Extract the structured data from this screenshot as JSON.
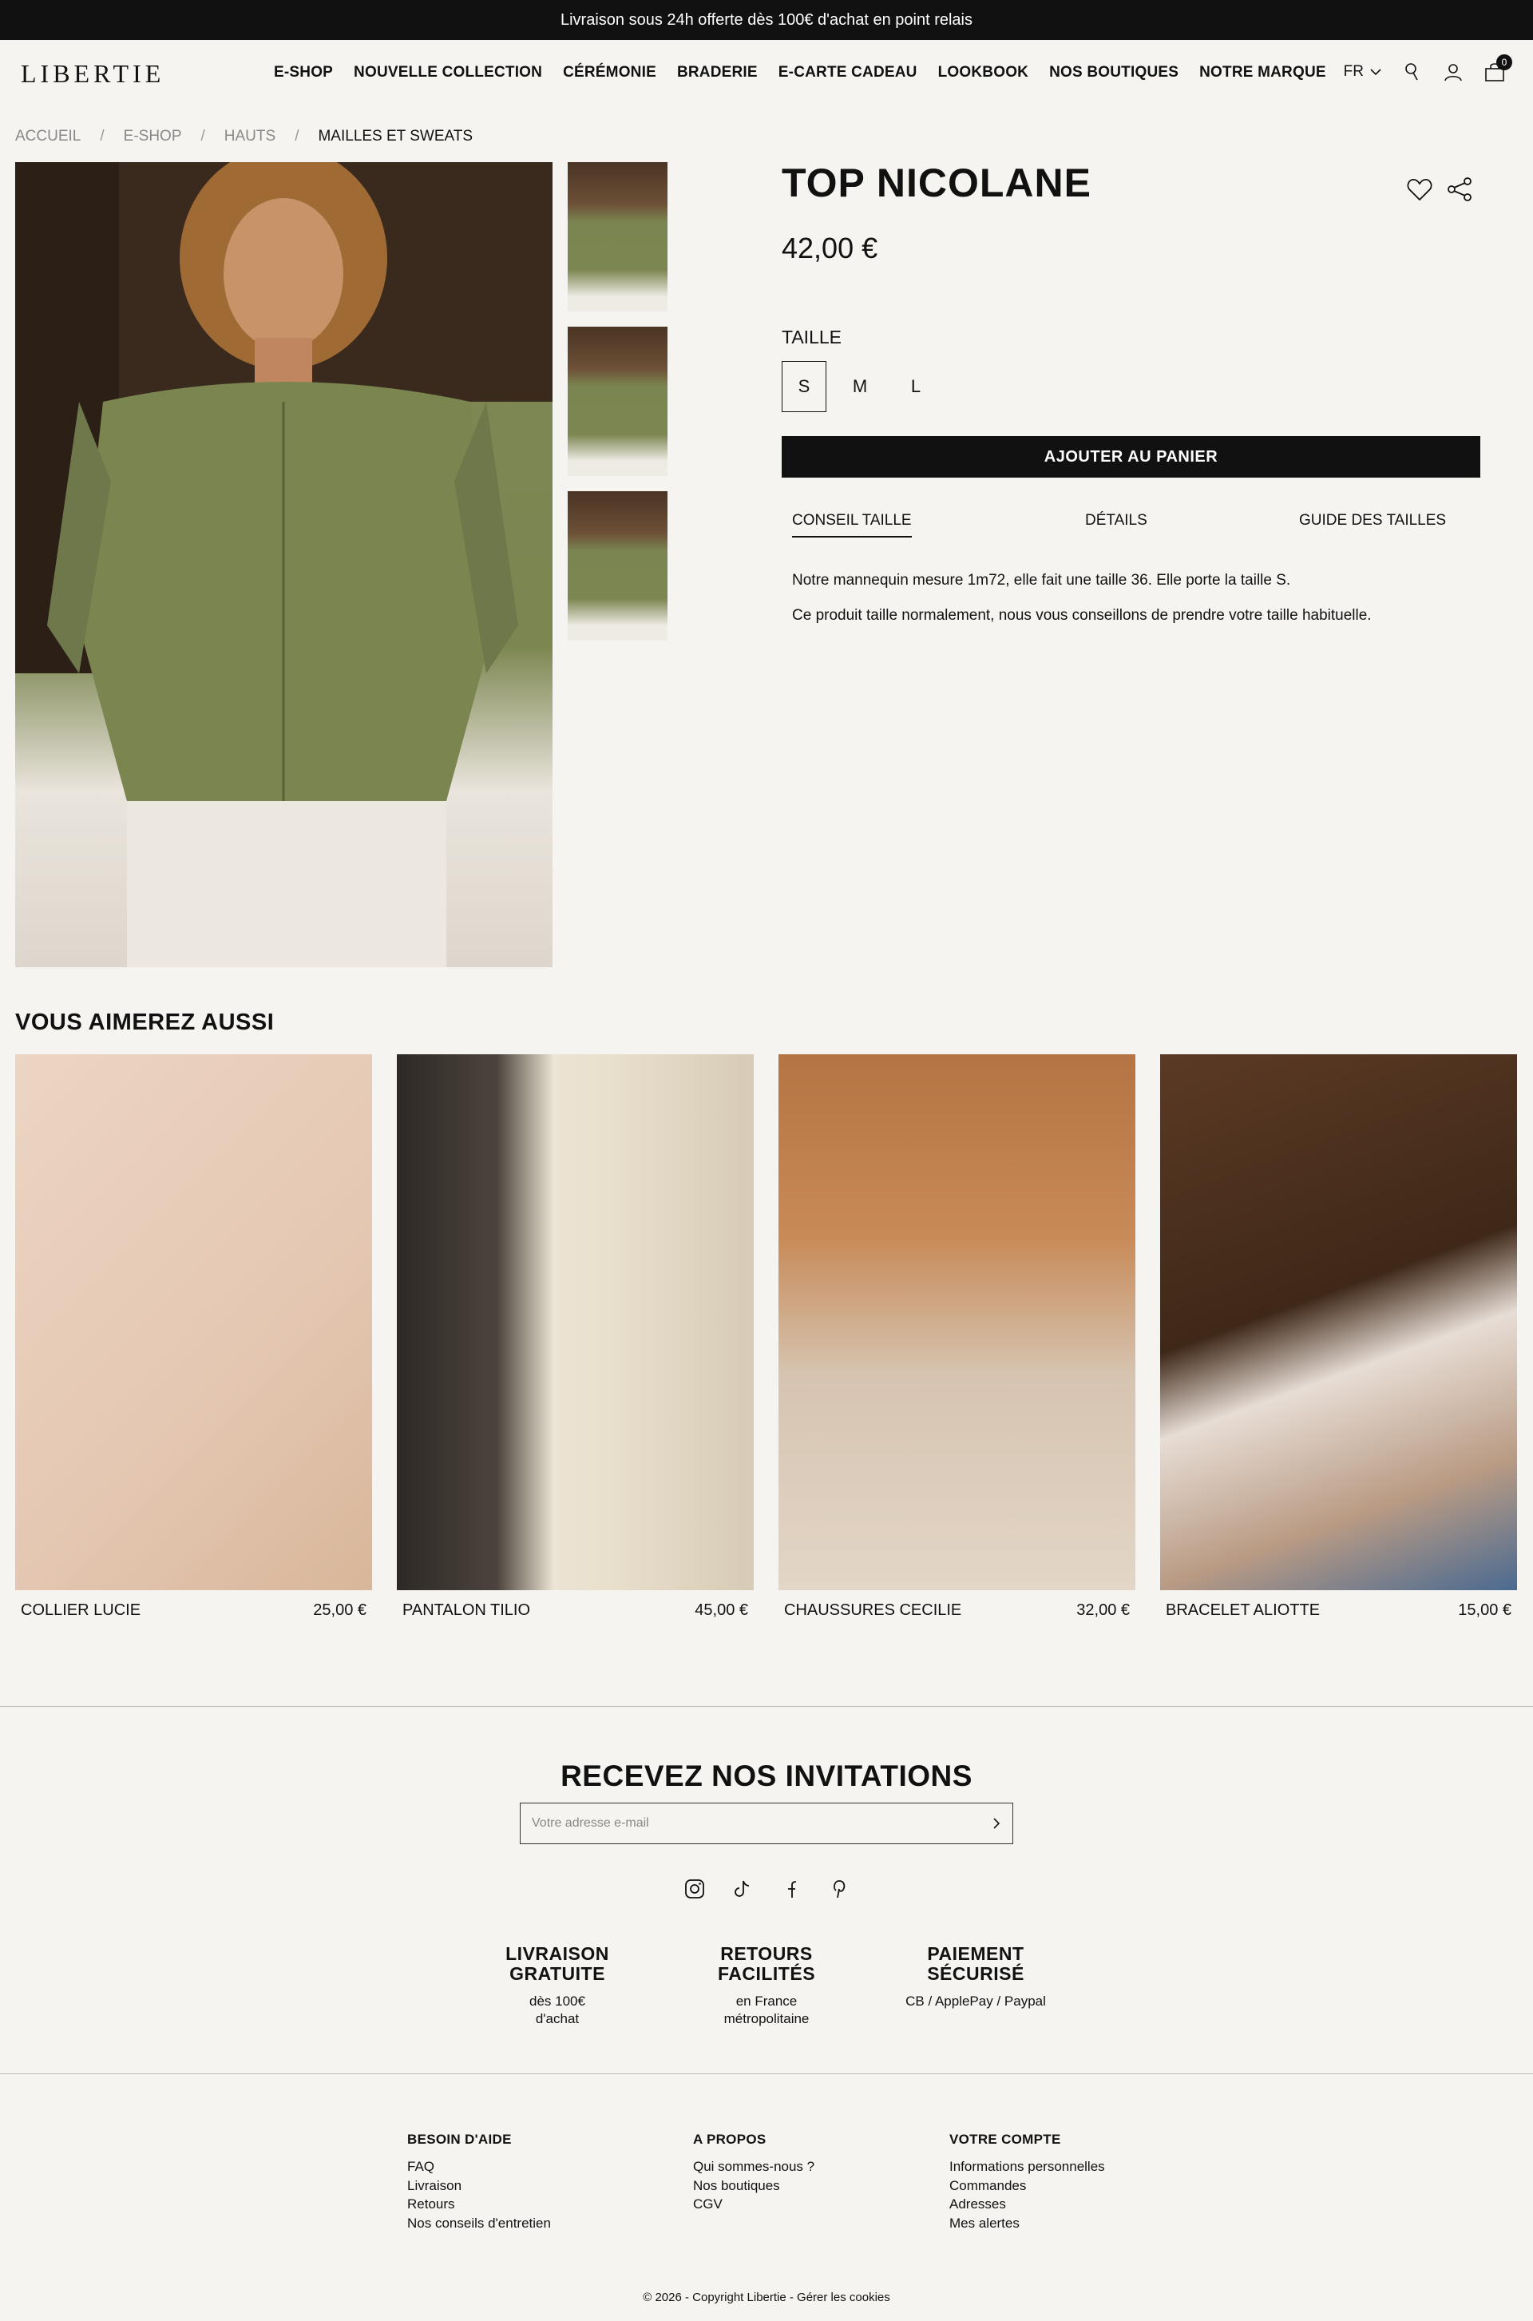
{
  "topbar": {
    "text": "Livraison sous 24h offerte dès 100€ d'achat en point relais"
  },
  "header": {
    "logo": "LIBERTIE",
    "nav": [
      "E-SHOP",
      "NOUVELLE COLLECTION",
      "CÉRÉMONIE",
      "BRADERIE",
      "E-CARTE CADEAU",
      "LOOKBOOK",
      "NOS BOUTIQUES",
      "NOTRE MARQUE"
    ],
    "lang": "FR",
    "cart_count": "0"
  },
  "breadcrumb": {
    "items": [
      "ACCUEIL",
      "E-SHOP",
      "HAUTS",
      "MAILLES ET SWEATS"
    ],
    "sep": "/"
  },
  "product": {
    "title": "TOP NICOLANE",
    "price": "42,00 €",
    "size_label": "TAILLE",
    "sizes": [
      "S",
      "M",
      "L"
    ],
    "selected_size": "S",
    "add_to_cart": "AJOUTER AU PANIER",
    "tabs": [
      "CONSEIL TAILLE",
      "DÉTAILS",
      "GUIDE DES TAILLES"
    ],
    "advice": [
      "Notre mannequin mesure 1m72, elle fait une taille 36. Elle porte la taille S.",
      "Ce produit taille normalement, nous vous conseillons de prendre votre taille habituelle."
    ]
  },
  "recommend": {
    "title": "VOUS AIMEREZ AUSSI",
    "items": [
      {
        "name": "COLLIER LUCIE",
        "price": "25,00 €"
      },
      {
        "name": "PANTALON TILIO",
        "price": "45,00 €"
      },
      {
        "name": "CHAUSSURES CECILIE",
        "price": "32,00 €"
      },
      {
        "name": "BRACELET ALIOTTE",
        "price": "15,00 €"
      }
    ]
  },
  "newsletter": {
    "title": "RECEVEZ NOS INVITATIONS",
    "placeholder": "Votre adresse e-mail",
    "social": [
      "instagram-icon",
      "tiktok-icon",
      "facebook-icon",
      "pinterest-icon"
    ]
  },
  "features": [
    {
      "title1": "LIVRAISON",
      "title2": "GRATUITE",
      "line1": "dès 100€",
      "line2": "d'achat"
    },
    {
      "title1": "RETOURS",
      "title2": "FACILITÉS",
      "line1": "en France",
      "line2": "métropolitaine"
    },
    {
      "title1": "PAIEMENT",
      "title2": "SÉCURISÉ",
      "line1": "CB / ApplePay / Paypal",
      "line2": ""
    }
  ],
  "footer": {
    "cols": [
      {
        "title": "BESOIN D'AIDE",
        "links": [
          "FAQ",
          "Livraison",
          "Retours",
          "Nos conseils d'entretien"
        ]
      },
      {
        "title": "A PROPOS",
        "links": [
          "Qui sommes-nous ?",
          "Nos boutiques",
          "CGV"
        ]
      },
      {
        "title": "VOTRE COMPTE",
        "links": [
          "Informations personnelles",
          "Commandes",
          "Adresses",
          "Mes alertes"
        ]
      }
    ],
    "copyright": "© 2026 - Copyright Libertie - Gérer les cookies"
  }
}
